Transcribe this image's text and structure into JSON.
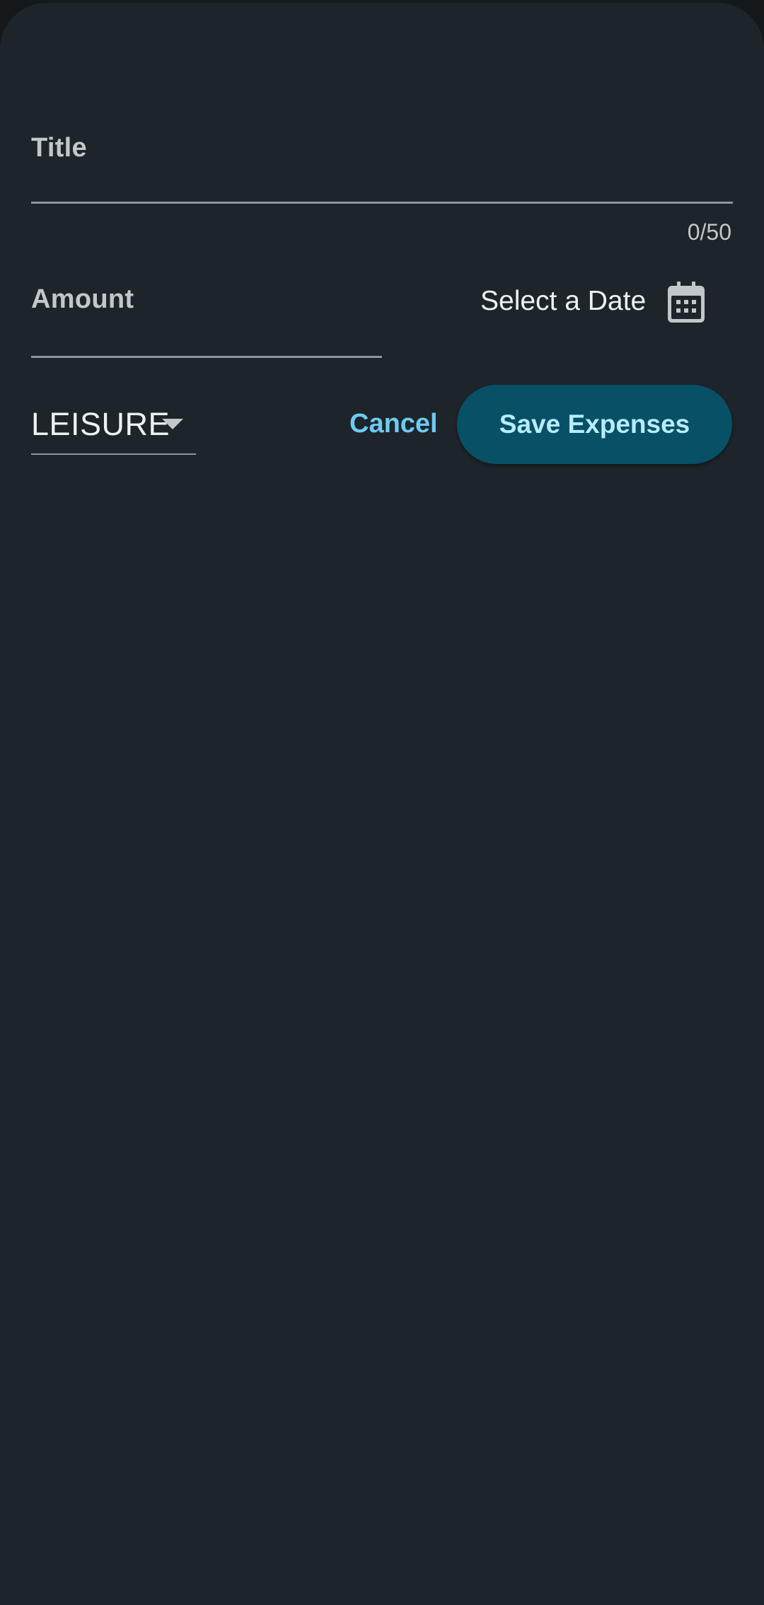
{
  "form": {
    "title_label": "Title",
    "title_value": "",
    "title_counter": "0/50",
    "amount_label": "Amount",
    "amount_value": "",
    "date_text": "Select a Date",
    "calendar_icon": "calendar-icon",
    "category_selected": "LEISURE",
    "cancel_label": "Cancel",
    "save_label": "Save Expenses"
  },
  "colors": {
    "sheet_background": "#1d242a",
    "accent_text": "#6ccbf3",
    "save_button_background": "#085066",
    "save_button_text": "#b7ecff"
  }
}
